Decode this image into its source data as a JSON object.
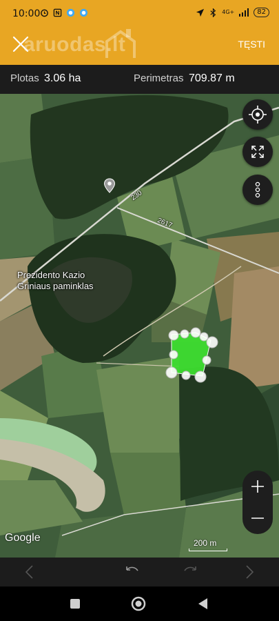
{
  "status_bar": {
    "time": "10:00",
    "network": "4G+",
    "battery": "82"
  },
  "app_bar": {
    "logo": "aruodas",
    "logo_suffix": ".lt",
    "next_label": "TĘSTI"
  },
  "info_bar": {
    "area_label": "Plotas",
    "area_value": "3.06 ha",
    "perimeter_label": "Perimetras",
    "perimeter_value": "709.87 m"
  },
  "map": {
    "poi_line1": "Prezidento Kazio",
    "poi_line2": "Griniaus paminklas",
    "road_230": "230",
    "road_2617": "2617",
    "attribution": "Google",
    "scale": "200 m",
    "polygon_color": "#3ddc2f"
  },
  "colors": {
    "accent": "#e8a623",
    "toolbar": "#1c1c1c"
  }
}
